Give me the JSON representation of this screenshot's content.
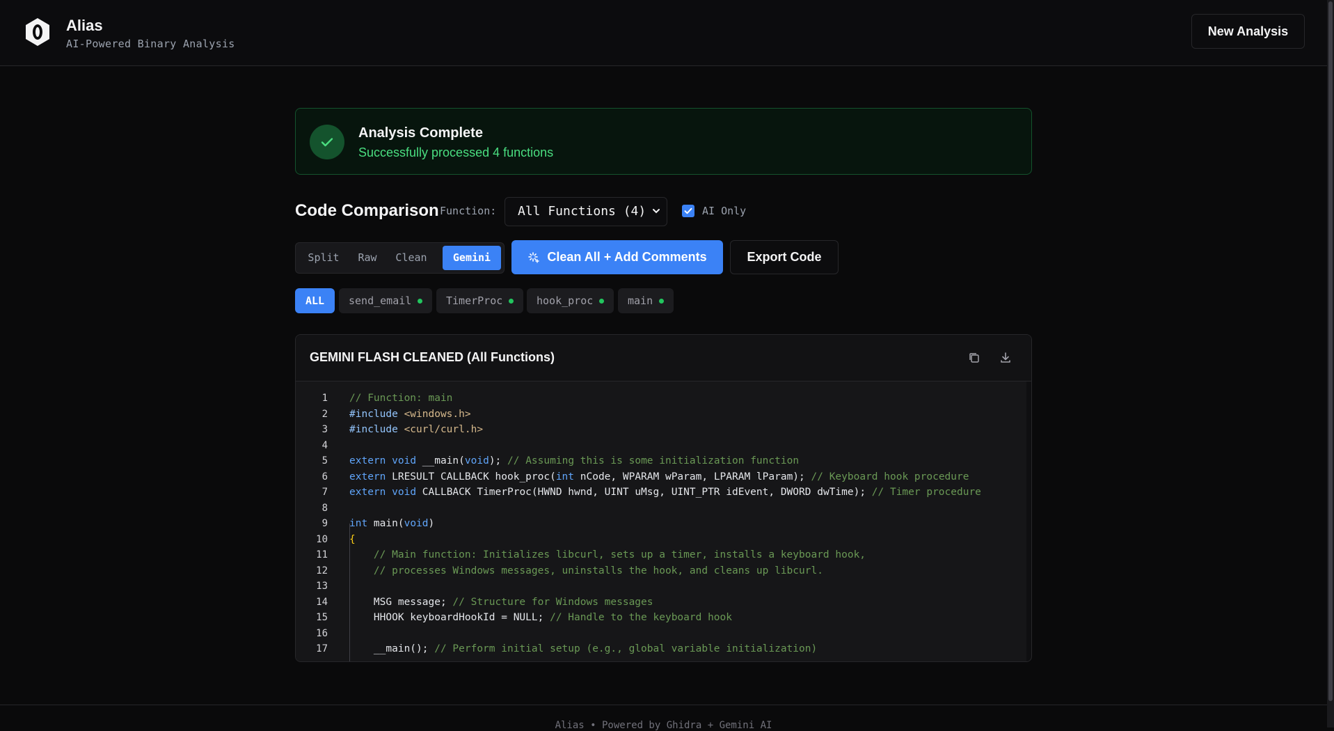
{
  "header": {
    "title": "Alias",
    "subtitle": "AI-Powered Binary Analysis",
    "new_analysis_label": "New Analysis"
  },
  "banner": {
    "title": "Analysis Complete",
    "message": "Successfully processed 4 functions"
  },
  "comparison": {
    "title": "Code Comparison",
    "function_label": "Function:",
    "function_selected": "All Functions (4)",
    "ai_only_label": "AI Only",
    "ai_only_checked": true,
    "views": [
      "Split",
      "Raw",
      "Clean",
      "Gemini"
    ],
    "active_view": "Gemini",
    "clean_all_label": "Clean All + Add Comments",
    "export_label": "Export Code"
  },
  "function_chips": [
    {
      "label": "ALL",
      "active": true,
      "status": ""
    },
    {
      "label": "send_email",
      "active": false,
      "status": "green"
    },
    {
      "label": "TimerProc",
      "active": false,
      "status": "green"
    },
    {
      "label": "hook_proc",
      "active": false,
      "status": "green"
    },
    {
      "label": "main",
      "active": false,
      "status": "green"
    }
  ],
  "panel": {
    "title": "GEMINI FLASH CLEANED (All Functions)",
    "icons": [
      "copy-icon",
      "download-icon"
    ]
  },
  "code_lines": [
    "// Function: main",
    "#include <windows.h>",
    "#include <curl/curl.h>",
    "",
    "extern void __main(void); // Assuming this is some initialization function",
    "extern LRESULT CALLBACK hook_proc(int nCode, WPARAM wParam, LPARAM lParam); // Keyboard hook procedure",
    "extern void CALLBACK TimerProc(HWND hwnd, UINT uMsg, UINT_PTR idEvent, DWORD dwTime); // Timer procedure",
    "",
    "int main(void)",
    "{",
    "    // Main function: Initializes libcurl, sets up a timer, installs a keyboard hook,",
    "    // processes Windows messages, uninstalls the hook, and cleans up libcurl.",
    "",
    "    MSG message; // Structure for Windows messages",
    "    HHOOK keyboardHookId = NULL; // Handle to the keyboard hook",
    "",
    "    __main(); // Perform initial setup (e.g., global variable initialization)"
  ],
  "footer": {
    "text": "Alias • Powered by Ghidra + Gemini AI"
  },
  "colors": {
    "accent": "#3b82f6",
    "success": "#4ade80",
    "background": "#0a0a0b"
  }
}
